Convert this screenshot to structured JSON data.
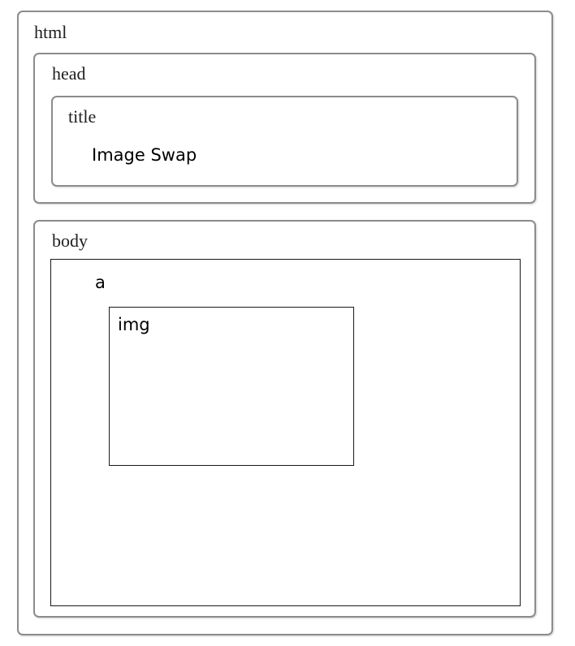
{
  "diagram": {
    "html": {
      "label": "html"
    },
    "head": {
      "label": "head"
    },
    "title": {
      "label": "title",
      "text": "Image Swap"
    },
    "body": {
      "label": "body"
    },
    "a": {
      "label": "a"
    },
    "img": {
      "label": "img"
    }
  }
}
